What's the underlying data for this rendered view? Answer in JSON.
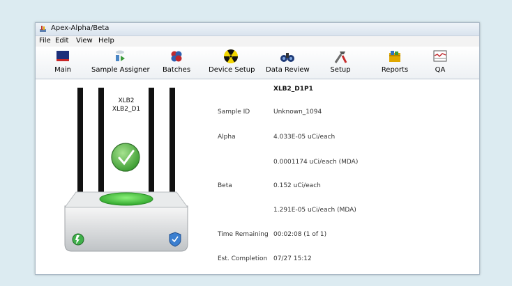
{
  "window": {
    "title": "Apex-Alpha/Beta"
  },
  "menu": [
    "File",
    "Edit",
    "View",
    "Help"
  ],
  "toolbar": [
    {
      "label": "Main",
      "icon": "main-icon"
    },
    {
      "label": "Sample Assigner",
      "icon": "sample-assigner-icon"
    },
    {
      "label": "Batches",
      "icon": "batches-icon"
    },
    {
      "label": "Device Setup",
      "icon": "radiation-icon"
    },
    {
      "label": "Data Review",
      "icon": "binoculars-icon"
    },
    {
      "label": "Setup",
      "icon": "tools-icon"
    },
    {
      "label": "Reports",
      "icon": "reports-icon"
    },
    {
      "label": "QA",
      "icon": "qa-chart-icon"
    }
  ],
  "device": {
    "line1": "XLB2",
    "line2": "XLB2_D1",
    "status": "ok"
  },
  "detector": {
    "heading": "XLB2_D1P1",
    "rows": [
      {
        "label": "Sample ID",
        "value": "Unknown_1094"
      },
      {
        "label": "Alpha",
        "value": "4.033E-05 uCi/each"
      },
      {
        "label": "",
        "value": "0.0001174 uCi/each (MDA)"
      },
      {
        "label": "Beta",
        "value": "0.152 uCi/each"
      },
      {
        "label": "",
        "value": "1.291E-05 uCi/each (MDA)"
      },
      {
        "label": "Time Remaining",
        "value": "00:02:08 (1 of 1)"
      },
      {
        "label": "Est. Completion",
        "value": "07/27 15:12"
      }
    ]
  },
  "colors": {
    "background": "#dcebf1",
    "ok_green": "#4cae3c",
    "tray_green": "#3fc43c"
  }
}
